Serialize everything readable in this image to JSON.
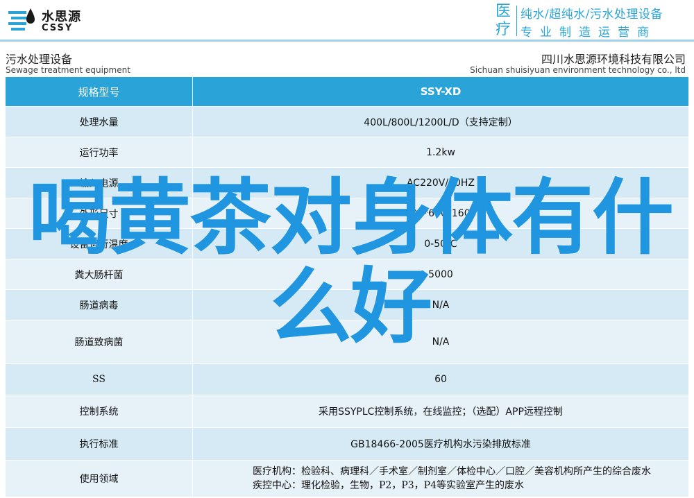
{
  "header": {
    "logo_cn": "水思源",
    "logo_en": "CSSY",
    "brand_big": "医疗",
    "brand_line1": "纯水/超纯水/污水处理设备",
    "brand_line2": "专业制造运营商"
  },
  "titles": {
    "left_cn": "污水处理设备",
    "left_en": "Sewage treatment equipment",
    "right_cn": "四川水思源环境科技有限公司",
    "right_en": "Sichuan shuisiyuan environment technology co., ltd"
  },
  "table": {
    "rows": [
      {
        "label": "规格型号",
        "value": "SSY-XD"
      },
      {
        "label": "处理水量",
        "value": "400L/800L/1200L/D（支持定制）"
      },
      {
        "label": "运行功率",
        "value": "1.2kw"
      },
      {
        "label": "输入电源",
        "value": "AC220V/50HZ"
      },
      {
        "label": "外形尺寸",
        "value": "600*600*1600"
      },
      {
        "label": "设备运行温度",
        "value": "0-50℃"
      },
      {
        "label": "粪大肠杆菌",
        "value": "5000"
      },
      {
        "label": "肠道病毒",
        "value": "N/A"
      },
      {
        "label": "肠道致病菌",
        "value": "N/A"
      },
      {
        "label": "SS",
        "value": "60"
      },
      {
        "label": "控制系统",
        "value": "采用SSYPLC控制系统，在线监控；（选配）APP远程控制"
      },
      {
        "label": "执行标准",
        "value": "GB18466-2005医疗机构水污染排放标准"
      },
      {
        "label": "使用领域",
        "value_line1": "医疗机构：检验科、病理科／手术室／制剂室／体检中心／口腔／美容机构所产生的综合废水",
        "value_line2": "疾控中心：理化检验，生物，P2，P3，P4等实验室产生的废水"
      }
    ]
  },
  "overlay": {
    "line1": "喝黄茶对身体有什",
    "line2": "么好"
  },
  "colors": {
    "accent": "#2aa4d8",
    "row_odd": "#d5eaf4",
    "row_even": "#e7f2f8",
    "overlay": "#2196e0"
  },
  "icons": [
    "water-drop-logo-icon"
  ]
}
